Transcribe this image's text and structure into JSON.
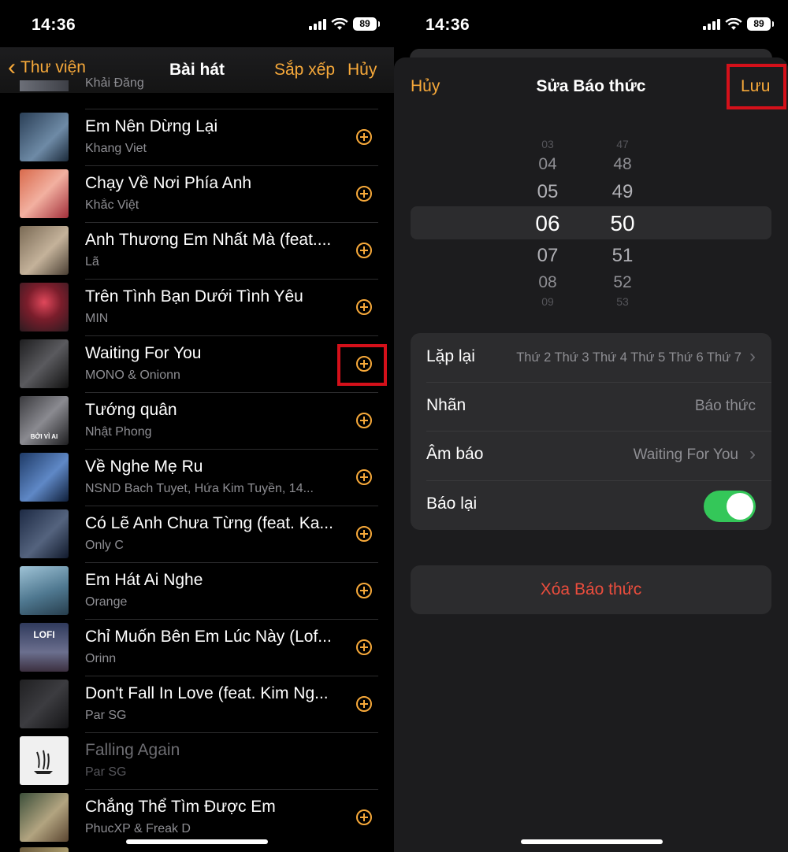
{
  "left": {
    "status": {
      "time": "14:36",
      "battery": "89"
    },
    "nav": {
      "back_label": "Thư viện",
      "title": "Bài hát",
      "sort_label": "Sắp xếp",
      "cancel_label": "Hủy"
    },
    "partial_artist": "Khải Đăng",
    "songs": [
      {
        "title": "Em Nên Dừng Lại",
        "artist": "Khang Viet",
        "addable": true
      },
      {
        "title": "Chạy Về Nơi Phía Anh",
        "artist": "Khắc Việt",
        "addable": true
      },
      {
        "title": "Anh Thương Em Nhất Mà (feat....",
        "artist": "Lã",
        "addable": true
      },
      {
        "title": "Trên Tình Bạn Dưới Tình Yêu",
        "artist": "MIN",
        "addable": true
      },
      {
        "title": "Waiting For You",
        "artist": "MONO & Onionn",
        "addable": true
      },
      {
        "title": "Tướng quân",
        "artist": "Nhật Phong",
        "addable": true
      },
      {
        "title": "Về Nghe Mẹ Ru",
        "artist": "NSND Bach Tuyet, Hứa Kim Tuyền, 14...",
        "addable": true
      },
      {
        "title": "Có Lẽ Anh Chưa Từng (feat. Ka...",
        "artist": "Only C",
        "addable": true
      },
      {
        "title": "Em Hát Ai Nghe",
        "artist": "Orange",
        "addable": true
      },
      {
        "title": "Chỉ Muốn Bên Em Lúc Này (Lof...",
        "artist": "Orinn",
        "addable": true
      },
      {
        "title": "Don't Fall In Love (feat. Kim Ng...",
        "artist": "Par SG",
        "addable": true
      },
      {
        "title": "Falling Again",
        "artist": "Par SG",
        "addable": false
      },
      {
        "title": "Chẳng Thể Tìm Được Em",
        "artist": "PhucXP & Freak D",
        "addable": true
      }
    ],
    "art_texts": {
      "a5": "BỞI VÌ AI",
      "a9": "LOFI"
    }
  },
  "right": {
    "status": {
      "time": "14:36",
      "battery": "89"
    },
    "sheet": {
      "cancel_label": "Hủy",
      "title": "Sửa Báo thức",
      "save_label": "Lưu"
    },
    "picker": {
      "hours": [
        "03",
        "04",
        "05",
        "06",
        "07",
        "08",
        "09"
      ],
      "minutes": [
        "47",
        "48",
        "49",
        "50",
        "51",
        "52",
        "53"
      ],
      "selected_hour": "06",
      "selected_minute": "50"
    },
    "settings": {
      "repeat_label": "Lặp lại",
      "repeat_value": "Thứ 2 Thứ 3 Thứ 4 Thứ 5 Thứ 6 Thứ 7",
      "label_label": "Nhãn",
      "label_placeholder": "Báo thức",
      "sound_label": "Âm báo",
      "sound_value": "Waiting For You",
      "snooze_label": "Báo lại",
      "snooze_on": true
    },
    "delete_label": "Xóa Báo thức"
  },
  "colors": {
    "accent": "#f7a93a",
    "destructive": "#eb4d3d",
    "toggle_on": "#34c759",
    "highlight": "#d4101a"
  }
}
